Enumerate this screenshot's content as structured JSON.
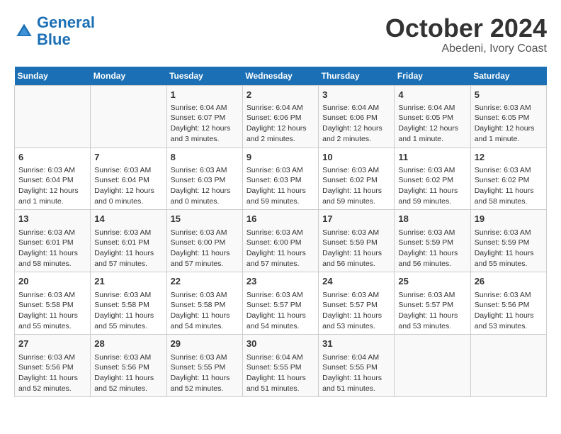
{
  "header": {
    "logo_line1": "General",
    "logo_line2": "Blue",
    "month": "October 2024",
    "location": "Abedeni, Ivory Coast"
  },
  "weekdays": [
    "Sunday",
    "Monday",
    "Tuesday",
    "Wednesday",
    "Thursday",
    "Friday",
    "Saturday"
  ],
  "weeks": [
    [
      {
        "day": "",
        "info": ""
      },
      {
        "day": "",
        "info": ""
      },
      {
        "day": "1",
        "info": "Sunrise: 6:04 AM\nSunset: 6:07 PM\nDaylight: 12 hours and 3 minutes."
      },
      {
        "day": "2",
        "info": "Sunrise: 6:04 AM\nSunset: 6:06 PM\nDaylight: 12 hours and 2 minutes."
      },
      {
        "day": "3",
        "info": "Sunrise: 6:04 AM\nSunset: 6:06 PM\nDaylight: 12 hours and 2 minutes."
      },
      {
        "day": "4",
        "info": "Sunrise: 6:04 AM\nSunset: 6:05 PM\nDaylight: 12 hours and 1 minute."
      },
      {
        "day": "5",
        "info": "Sunrise: 6:03 AM\nSunset: 6:05 PM\nDaylight: 12 hours and 1 minute."
      }
    ],
    [
      {
        "day": "6",
        "info": "Sunrise: 6:03 AM\nSunset: 6:04 PM\nDaylight: 12 hours and 1 minute."
      },
      {
        "day": "7",
        "info": "Sunrise: 6:03 AM\nSunset: 6:04 PM\nDaylight: 12 hours and 0 minutes."
      },
      {
        "day": "8",
        "info": "Sunrise: 6:03 AM\nSunset: 6:03 PM\nDaylight: 12 hours and 0 minutes."
      },
      {
        "day": "9",
        "info": "Sunrise: 6:03 AM\nSunset: 6:03 PM\nDaylight: 11 hours and 59 minutes."
      },
      {
        "day": "10",
        "info": "Sunrise: 6:03 AM\nSunset: 6:02 PM\nDaylight: 11 hours and 59 minutes."
      },
      {
        "day": "11",
        "info": "Sunrise: 6:03 AM\nSunset: 6:02 PM\nDaylight: 11 hours and 59 minutes."
      },
      {
        "day": "12",
        "info": "Sunrise: 6:03 AM\nSunset: 6:02 PM\nDaylight: 11 hours and 58 minutes."
      }
    ],
    [
      {
        "day": "13",
        "info": "Sunrise: 6:03 AM\nSunset: 6:01 PM\nDaylight: 11 hours and 58 minutes."
      },
      {
        "day": "14",
        "info": "Sunrise: 6:03 AM\nSunset: 6:01 PM\nDaylight: 11 hours and 57 minutes."
      },
      {
        "day": "15",
        "info": "Sunrise: 6:03 AM\nSunset: 6:00 PM\nDaylight: 11 hours and 57 minutes."
      },
      {
        "day": "16",
        "info": "Sunrise: 6:03 AM\nSunset: 6:00 PM\nDaylight: 11 hours and 57 minutes."
      },
      {
        "day": "17",
        "info": "Sunrise: 6:03 AM\nSunset: 5:59 PM\nDaylight: 11 hours and 56 minutes."
      },
      {
        "day": "18",
        "info": "Sunrise: 6:03 AM\nSunset: 5:59 PM\nDaylight: 11 hours and 56 minutes."
      },
      {
        "day": "19",
        "info": "Sunrise: 6:03 AM\nSunset: 5:59 PM\nDaylight: 11 hours and 55 minutes."
      }
    ],
    [
      {
        "day": "20",
        "info": "Sunrise: 6:03 AM\nSunset: 5:58 PM\nDaylight: 11 hours and 55 minutes."
      },
      {
        "day": "21",
        "info": "Sunrise: 6:03 AM\nSunset: 5:58 PM\nDaylight: 11 hours and 55 minutes."
      },
      {
        "day": "22",
        "info": "Sunrise: 6:03 AM\nSunset: 5:58 PM\nDaylight: 11 hours and 54 minutes."
      },
      {
        "day": "23",
        "info": "Sunrise: 6:03 AM\nSunset: 5:57 PM\nDaylight: 11 hours and 54 minutes."
      },
      {
        "day": "24",
        "info": "Sunrise: 6:03 AM\nSunset: 5:57 PM\nDaylight: 11 hours and 53 minutes."
      },
      {
        "day": "25",
        "info": "Sunrise: 6:03 AM\nSunset: 5:57 PM\nDaylight: 11 hours and 53 minutes."
      },
      {
        "day": "26",
        "info": "Sunrise: 6:03 AM\nSunset: 5:56 PM\nDaylight: 11 hours and 53 minutes."
      }
    ],
    [
      {
        "day": "27",
        "info": "Sunrise: 6:03 AM\nSunset: 5:56 PM\nDaylight: 11 hours and 52 minutes."
      },
      {
        "day": "28",
        "info": "Sunrise: 6:03 AM\nSunset: 5:56 PM\nDaylight: 11 hours and 52 minutes."
      },
      {
        "day": "29",
        "info": "Sunrise: 6:03 AM\nSunset: 5:55 PM\nDaylight: 11 hours and 52 minutes."
      },
      {
        "day": "30",
        "info": "Sunrise: 6:04 AM\nSunset: 5:55 PM\nDaylight: 11 hours and 51 minutes."
      },
      {
        "day": "31",
        "info": "Sunrise: 6:04 AM\nSunset: 5:55 PM\nDaylight: 11 hours and 51 minutes."
      },
      {
        "day": "",
        "info": ""
      },
      {
        "day": "",
        "info": ""
      }
    ]
  ]
}
